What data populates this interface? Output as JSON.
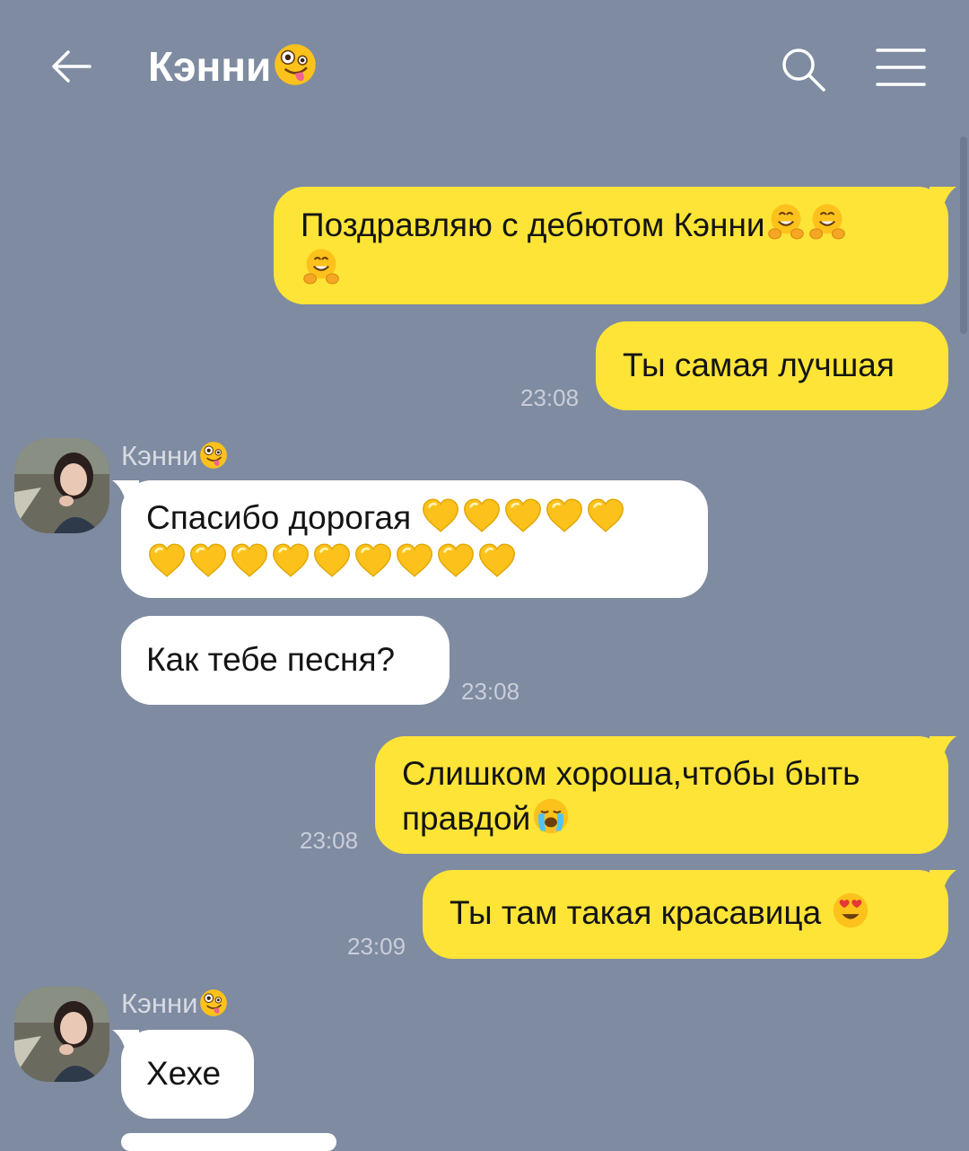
{
  "header": {
    "back_icon": "arrow-left-icon",
    "title": "Кэнни",
    "title_emoji": "zany-face",
    "search_icon": "search-icon",
    "menu_icon": "hamburger-menu-icon"
  },
  "messages": [
    {
      "text": "Поздравляю с дебютом Кэнни",
      "emojis": "hugging-face x3",
      "direction": "outgoing"
    },
    {
      "text": "Ты самая лучшая",
      "time": "23:08",
      "direction": "outgoing"
    },
    {
      "sender": "Кэнни",
      "text": "Спасибо дорогая",
      "emojis": "yellow-heart x14",
      "direction": "incoming"
    },
    {
      "text": "Как тебе песня?",
      "time": "23:08",
      "direction": "incoming"
    },
    {
      "text_line1": "Слишком хороша,чтобы быть",
      "text_line2": "правдой",
      "emojis": "loudly-crying-face",
      "time": "23:08",
      "direction": "outgoing"
    },
    {
      "text": "Ты там такая красавица",
      "emojis": "heart-eyes-face",
      "time": "23:09",
      "direction": "outgoing"
    },
    {
      "sender": "Кэнни",
      "text": "Хехе",
      "direction": "incoming"
    }
  ],
  "colors": {
    "background": "#7f8ba1",
    "outgoing_bubble": "#fde437",
    "incoming_bubble": "#ffffff"
  }
}
